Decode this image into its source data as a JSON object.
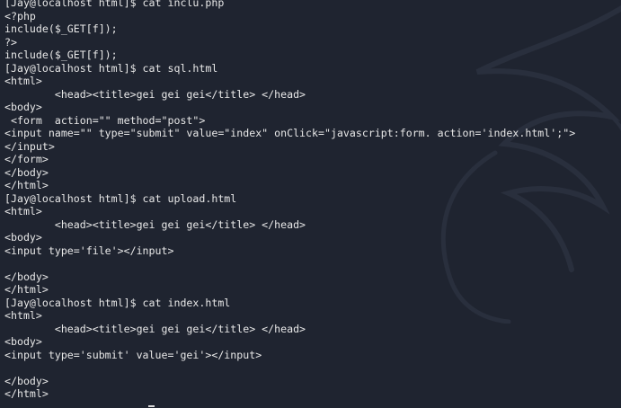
{
  "terminal": {
    "lines": [
      "[Jay@localhost html]$ cat inclu.php",
      "<?php",
      "include($_GET[f]);",
      "?>",
      "include($_GET[f]);",
      "[Jay@localhost html]$ cat sql.html",
      "<html>",
      "        <head><title>gei gei gei</title> </head>",
      "<body>",
      " <form  action=\"\" method=\"post\">",
      "<input name=\"\" type=\"submit\" value=\"index\" onClick=\"javascript:form. action='index.html';\">",
      "</input>",
      "</form>",
      "</body>",
      "</html>",
      "[Jay@localhost html]$ cat upload.html",
      "<html>",
      "        <head><title>gei gei gei</title> </head>",
      "<body>",
      "<input type='file'></input>",
      "",
      "</body>",
      "</html>",
      "[Jay@localhost html]$ cat index.html",
      "<html>",
      "        <head><title>gei gei gei</title> </head>",
      "<body>",
      "<input type='submit' value='gei'></input>",
      "",
      "</body>",
      "</html>"
    ]
  },
  "colors": {
    "background": "#1f2430",
    "text": "#e8e8e8",
    "watermark": "#3a4150"
  },
  "icons": {
    "watermark": "kali-dragon-watermark"
  }
}
